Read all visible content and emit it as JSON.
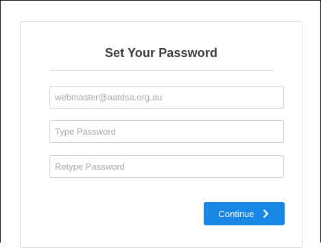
{
  "form": {
    "title": "Set Your Password",
    "email_placeholder": "webmaster@aatdsa.org.au",
    "password_placeholder": "Type Password",
    "retype_placeholder": "Retype Password",
    "continue_label": "Continue",
    "continue_icon": "chevron-right-icon"
  },
  "colors": {
    "accent": "#1a87e6",
    "title_text": "#3a3a3a",
    "placeholder_text": "#a8a8a8",
    "field_border": "#cfcfcf"
  }
}
